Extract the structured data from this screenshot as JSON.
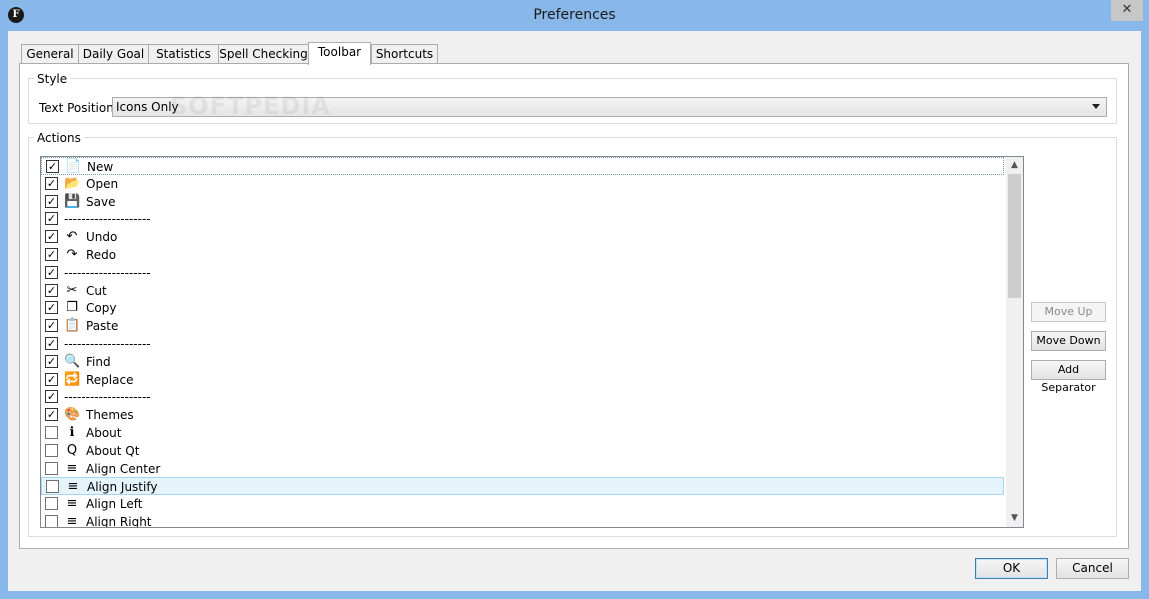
{
  "window": {
    "title": "Preferences",
    "app_icon_letter": "F",
    "close_glyph": "✕"
  },
  "tabs": [
    {
      "label": "General",
      "active": false
    },
    {
      "label": "Daily Goal",
      "active": false
    },
    {
      "label": "Statistics",
      "active": false
    },
    {
      "label": "Spell Checking",
      "active": false
    },
    {
      "label": "Toolbar",
      "active": true
    },
    {
      "label": "Shortcuts",
      "active": false
    }
  ],
  "style_group": {
    "title": "Style",
    "text_position_label": "Text Position:",
    "text_position_value": "Icons Only"
  },
  "watermark": "SOFTPEDIA",
  "actions_group": {
    "title": "Actions",
    "items": [
      {
        "label": "New",
        "checked": true,
        "icon": "new-document-icon",
        "glyph": "📄"
      },
      {
        "label": "Open",
        "checked": true,
        "icon": "open-icon",
        "glyph": "📂"
      },
      {
        "label": "Save",
        "checked": true,
        "icon": "save-icon",
        "glyph": "💾"
      },
      {
        "label": "--------------------",
        "checked": true,
        "icon": "",
        "glyph": ""
      },
      {
        "label": "Undo",
        "checked": true,
        "icon": "undo-icon",
        "glyph": "↶"
      },
      {
        "label": "Redo",
        "checked": true,
        "icon": "redo-icon",
        "glyph": "↷"
      },
      {
        "label": "--------------------",
        "checked": true,
        "icon": "",
        "glyph": ""
      },
      {
        "label": "Cut",
        "checked": true,
        "icon": "scissors-icon",
        "glyph": "✂"
      },
      {
        "label": "Copy",
        "checked": true,
        "icon": "copy-icon",
        "glyph": "❐"
      },
      {
        "label": "Paste",
        "checked": true,
        "icon": "paste-icon",
        "glyph": "📋"
      },
      {
        "label": "--------------------",
        "checked": true,
        "icon": "",
        "glyph": ""
      },
      {
        "label": "Find",
        "checked": true,
        "icon": "binoculars-icon",
        "glyph": "🔍"
      },
      {
        "label": "Replace",
        "checked": true,
        "icon": "replace-icon",
        "glyph": "🔁"
      },
      {
        "label": "--------------------",
        "checked": true,
        "icon": "",
        "glyph": ""
      },
      {
        "label": "Themes",
        "checked": true,
        "icon": "palette-icon",
        "glyph": "🎨"
      },
      {
        "label": "About",
        "checked": false,
        "icon": "info-icon",
        "glyph": "ℹ"
      },
      {
        "label": "About Qt",
        "checked": false,
        "icon": "qt-icon",
        "glyph": "Q"
      },
      {
        "label": "Align Center",
        "checked": false,
        "icon": "align-center-icon",
        "glyph": "≡"
      },
      {
        "label": "Align Justify",
        "checked": false,
        "icon": "align-justify-icon",
        "glyph": "≡"
      },
      {
        "label": "Align Left",
        "checked": false,
        "icon": "align-left-icon",
        "glyph": "≡"
      },
      {
        "label": "Align Right",
        "checked": false,
        "icon": "align-right-icon",
        "glyph": "≡"
      }
    ],
    "check_glyph": "✓",
    "scroll_up_glyph": "▲",
    "scroll_down_glyph": "▼"
  },
  "side_buttons": {
    "move_up": "Move Up",
    "move_down": "Move Down",
    "add_separator": "Add Separator"
  },
  "dialog_buttons": {
    "ok": "OK",
    "cancel": "Cancel"
  },
  "colors": {
    "titlebar": "#88b8ea",
    "hover_row": "#e5f3fb"
  }
}
